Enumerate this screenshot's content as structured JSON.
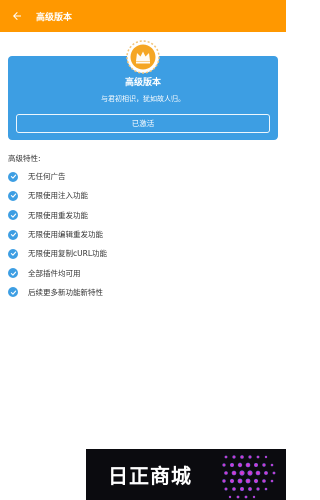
{
  "appbar": {
    "title": "高级版本",
    "back_icon": "arrow-left-icon"
  },
  "card": {
    "badge_icon": "premium-crown-icon",
    "title": "高级版本",
    "subtitle": "与君初相识，犹如故人归。",
    "activated_label": "已激活"
  },
  "features": {
    "heading": "高级特性:",
    "check_icon": "check-circle-icon",
    "items": [
      "无任何广告",
      "无限使用注入功能",
      "无限使用重发功能",
      "无限使用编辑重发功能",
      "无限使用复制cURL功能",
      "全部插件均可用",
      "后续更多新功能新特性"
    ]
  },
  "watermark": {
    "text": "日正商城"
  },
  "colors": {
    "appbar": "#ff9800",
    "card": "#3d9ee3",
    "badge": "#f5a623",
    "check": "#3d9ee3"
  }
}
